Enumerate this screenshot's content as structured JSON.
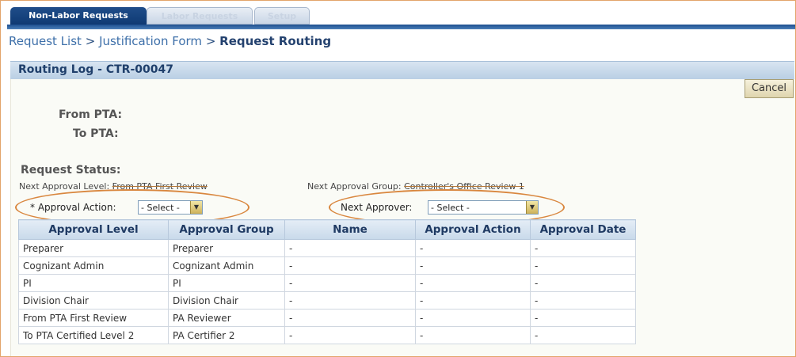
{
  "tabs": [
    {
      "label": "Non-Labor Requests"
    },
    {
      "label": "Labor Requests"
    },
    {
      "label": "Setup"
    }
  ],
  "breadcrumb": {
    "item1": "Request List",
    "sep": ">",
    "item2": "Justification Form",
    "current": "Request Routing"
  },
  "section": {
    "title": "Routing Log - CTR-00047"
  },
  "cancel_label": "Cancel",
  "fields": {
    "from_pta": "From PTA:",
    "to_pta": "To PTA:",
    "request_status": "Request Status:",
    "next_level_label": "Next Approval Level:",
    "next_level_value": "From PTA First Review",
    "next_group_label": "Next Approval Group:",
    "next_group_value": "Controller's Office Review 1",
    "approval_action_label": "* Approval Action:",
    "approval_action_value": "- Select -",
    "next_approver_label": "Next Approver:",
    "next_approver_value": "- Select -"
  },
  "table": {
    "headers": [
      "Approval Level",
      "Approval Group",
      "Name",
      "Approval Action",
      "Approval Date"
    ],
    "rows": [
      [
        "Preparer",
        "Preparer",
        "-",
        "-",
        "-"
      ],
      [
        "Cognizant Admin",
        "Cognizant Admin",
        "-",
        "-",
        "-"
      ],
      [
        "PI",
        "PI",
        "-",
        "-",
        "-"
      ],
      [
        "Division Chair",
        "Division Chair",
        "-",
        "-",
        "-"
      ],
      [
        "From PTA First Review",
        "PA Reviewer",
        "-",
        "-",
        "-"
      ],
      [
        "To PTA Certified Level 2",
        "PA Certifier 2",
        "-",
        "-",
        "-"
      ]
    ]
  },
  "colors": {
    "highlight": "#d9873f",
    "tab_active": "#1f4d8a"
  }
}
